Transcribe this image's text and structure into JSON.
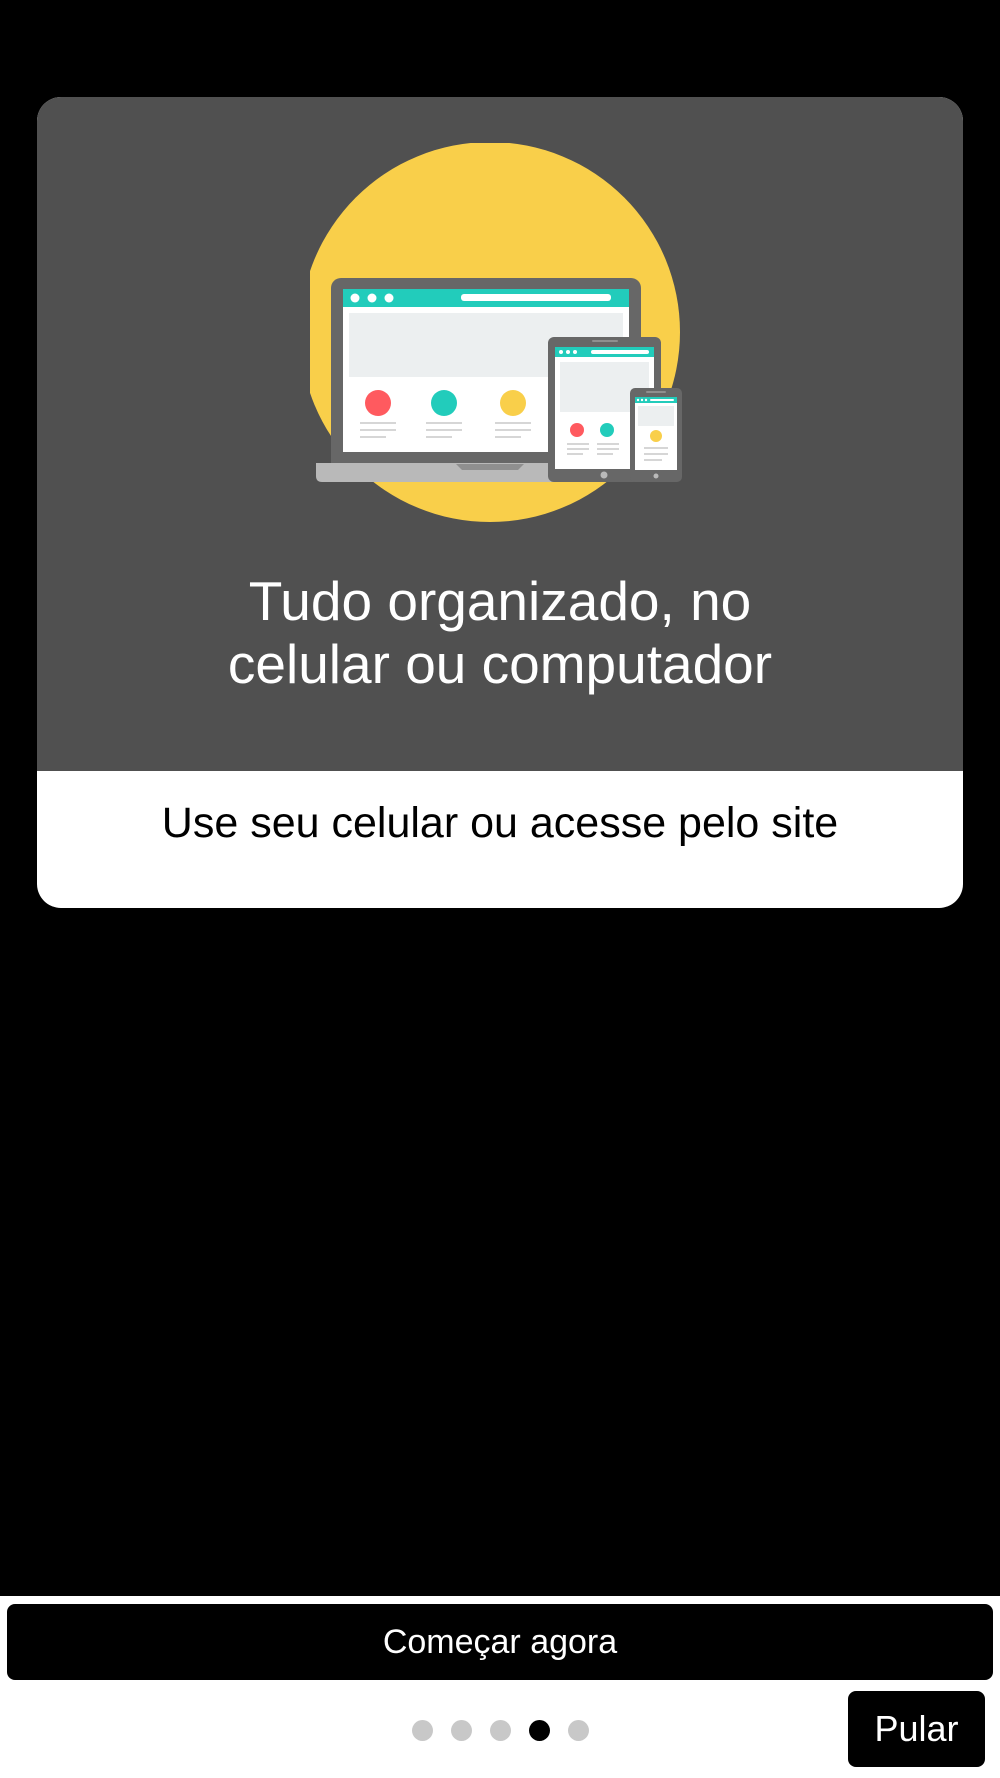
{
  "slide": {
    "illustration": "responsive-devices-illustration",
    "title_line1": "Tudo organizado, no",
    "title_line2": "celular ou computador",
    "subtitle": "Use seu celular ou acesse pelo site"
  },
  "footer": {
    "start_label": "Começar agora",
    "skip_label": "Pular",
    "pagination": {
      "total": 5,
      "current": 4
    }
  },
  "colors": {
    "background": "#000000",
    "card_header": "#505050",
    "accent_yellow": "#F9CF4A",
    "accent_teal": "#22CCBB",
    "accent_red": "#FF5A5F",
    "dot_inactive": "#C8C8C8",
    "dot_active": "#000000"
  }
}
